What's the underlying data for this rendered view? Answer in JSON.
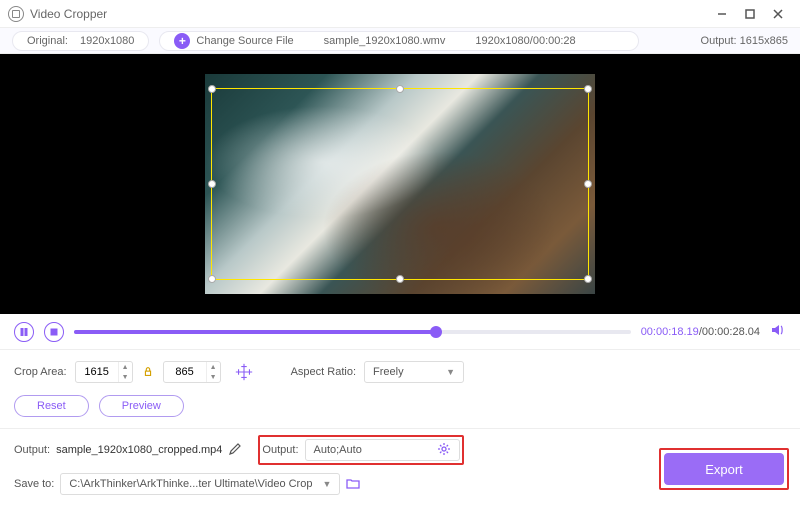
{
  "app": {
    "title": "Video Cropper"
  },
  "infobar": {
    "original_label": "Original:",
    "original_value": "1920x1080",
    "change_source_label": "Change Source File",
    "filename": "sample_1920x1080.wmv",
    "dims_time": "1920x1080/00:00:28",
    "output_label": "Output:",
    "output_value": "1615x865"
  },
  "playback": {
    "current_time": "00:00:18.19",
    "total_time": "00:00:28.04"
  },
  "crop": {
    "area_label": "Crop Area:",
    "width": "1615",
    "height": "865",
    "aspect_label": "Aspect Ratio:",
    "aspect_value": "Freely"
  },
  "buttons": {
    "reset": "Reset",
    "preview": "Preview",
    "export": "Export"
  },
  "output": {
    "label": "Output:",
    "filename": "sample_1920x1080_cropped.mp4",
    "settings_label": "Output:",
    "settings_value": "Auto;Auto"
  },
  "save": {
    "label": "Save to:",
    "path": "C:\\ArkThinker\\ArkThinke...ter Ultimate\\Video Crop"
  }
}
